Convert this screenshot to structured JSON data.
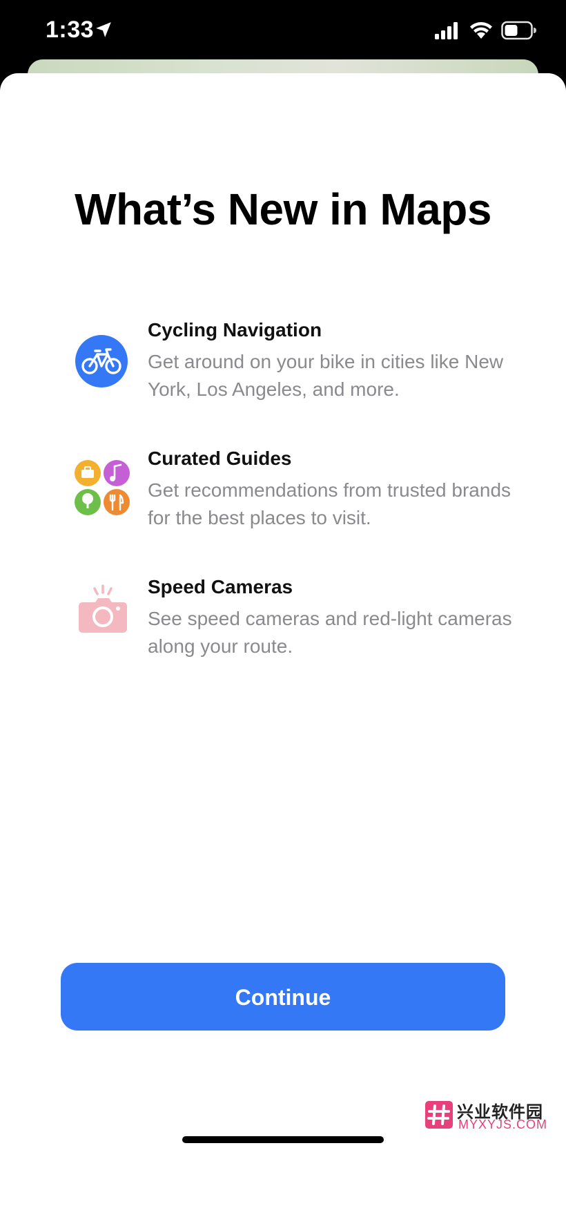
{
  "status_bar": {
    "time": "1:33",
    "icons": [
      "location-arrow-icon",
      "cellular-signal-icon",
      "wifi-icon",
      "battery-icon"
    ]
  },
  "sheet": {
    "title": "What’s New in Maps",
    "features": [
      {
        "icon": "bicycle-icon",
        "title": "Cycling Navigation",
        "description": "Get around on your bike in cities like New York, Los Angeles, and more.",
        "icon_color": "#3478f6"
      },
      {
        "icon": "guides-cluster-icon",
        "title": "Curated Guides",
        "description": "Get recommendations from trusted brands for the best places to visit.",
        "icon_colors": [
          "#f2b02e",
          "#c45fd6",
          "#6dbf4a",
          "#ee8a32"
        ]
      },
      {
        "icon": "speed-camera-icon",
        "title": "Speed Cameras",
        "description": "See speed cameras and red-light cameras along your route.",
        "icon_color": "#f4b8c1"
      }
    ],
    "continue_label": "Continue",
    "accent": "#3478f6"
  },
  "watermark": {
    "text_cn": "兴业软件园",
    "text_en": "MYXYJS.COM"
  }
}
